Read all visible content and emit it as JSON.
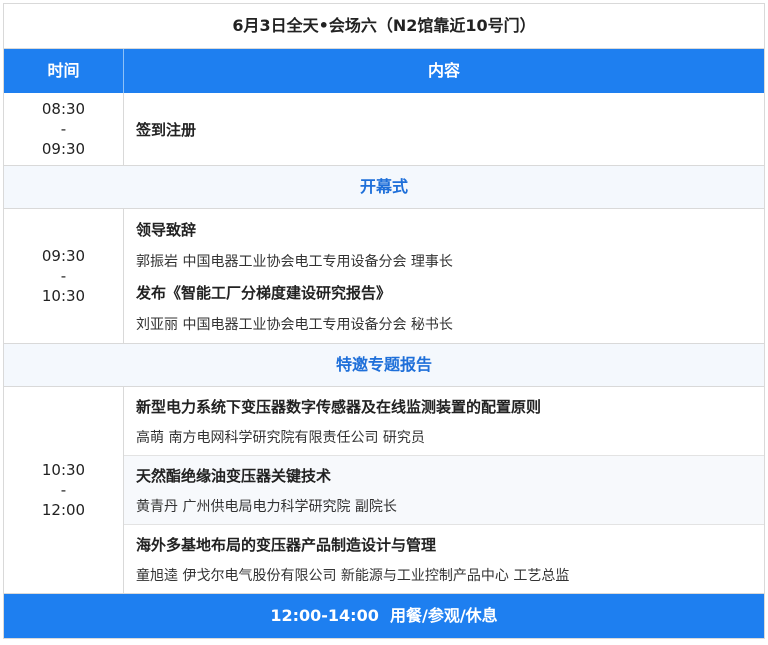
{
  "title": "6月3日全天•会场六（N2馆靠近10号门）",
  "header": {
    "time": "时间",
    "content": "内容"
  },
  "registration": {
    "start": "08:30",
    "sep": "-",
    "end": "09:30",
    "label": "签到注册"
  },
  "section_opening": "开幕式",
  "opening": {
    "start": "09:30",
    "sep": "-",
    "end": "10:30",
    "items": [
      {
        "title": "领导致辞",
        "speaker": "郭振岩 中国电器工业协会电工专用设备分会 理事长"
      },
      {
        "title": "发布《智能工厂分梯度建设研究报告》",
        "speaker": "刘亚丽 中国电器工业协会电工专用设备分会 秘书长"
      }
    ]
  },
  "section_reports": "特邀专题报告",
  "reports": {
    "start": "10:30",
    "sep": "-",
    "end": "12:00",
    "items": [
      {
        "title": "新型电力系统下变压器数字传感器及在线监测装置的配置原则",
        "speaker": "高萌 南方电网科学研究院有限责任公司 研究员"
      },
      {
        "title": "天然酯绝缘油变压器关键技术",
        "speaker": "黄青丹 广州供电局电力科学研究院 副院长"
      },
      {
        "title": "海外多基地布局的变压器产品制造设计与管理",
        "speaker": "童旭逵 伊戈尔电气股份有限公司 新能源与工业控制产品中心 工艺总监"
      }
    ]
  },
  "break_bar": "12:00-14:00  用餐/参观/休息"
}
